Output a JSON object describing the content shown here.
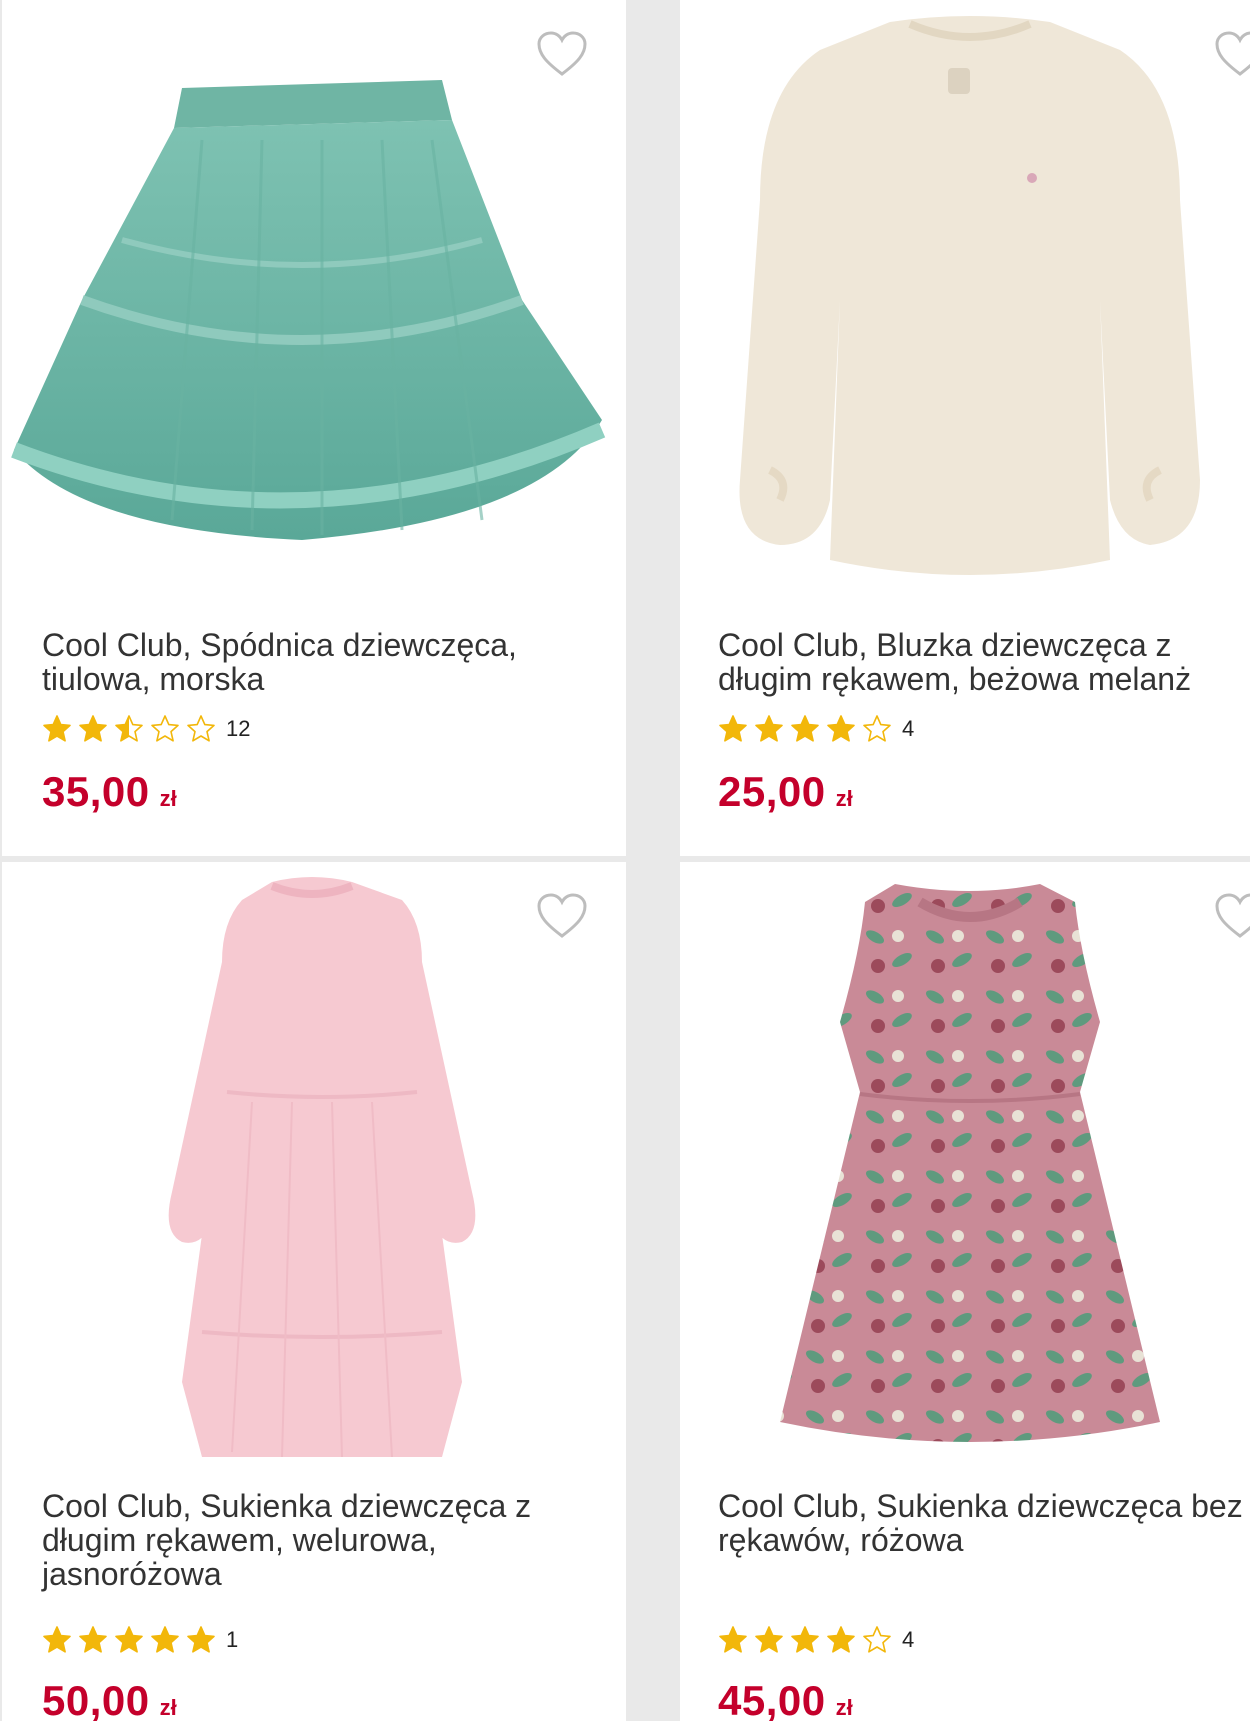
{
  "colors": {
    "price": "#c4002b",
    "star": "#f2b70a",
    "title": "#333333",
    "divider": "#e9e9e9"
  },
  "products": [
    {
      "title": "Cool Club, Spódnica dziewczęca, tiulowa, morska",
      "rating": 2.5,
      "reviews": "12",
      "price": "35,00",
      "currency": "zł",
      "image": "teal-tulle-skirt"
    },
    {
      "title": "Cool Club, Bluzka dziewczęca z długim rękawem, beżowa melanż",
      "rating": 4,
      "reviews": "4",
      "price": "25,00",
      "currency": "zł",
      "image": "beige-long-sleeve-top"
    },
    {
      "title": "Cool Club, Sukienka dziewczęca z długim rękawem, welurowa, jasnoróżowa",
      "rating": 5,
      "reviews": "1",
      "price": "50,00",
      "currency": "zł",
      "image": "pink-velour-dress"
    },
    {
      "title": "Cool Club, Sukienka dziewczęca bez rękawów, różowa",
      "rating": 4,
      "reviews": "4",
      "price": "45,00",
      "currency": "zł",
      "image": "pink-floral-dress"
    }
  ]
}
